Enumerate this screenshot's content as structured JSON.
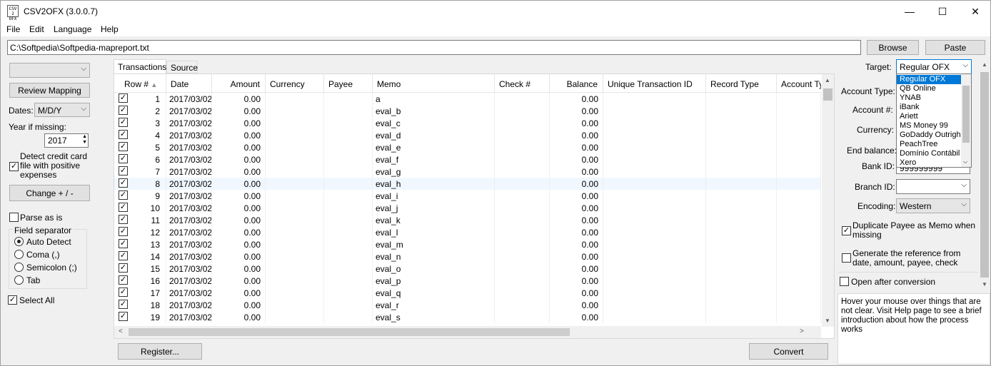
{
  "window": {
    "title": "CSV2OFX (3.0.0.7)",
    "icon_text": "CSV 2 OFX",
    "minimize": "—",
    "maximize": "☐",
    "close": "✕"
  },
  "menu": [
    "File",
    "Edit",
    "Language",
    "Help"
  ],
  "path": {
    "value": "C:\\Softpedia\\Softpedia-mapreport.txt"
  },
  "buttons": {
    "browse": "Browse",
    "paste": "Paste",
    "review_mapping": "Review Mapping",
    "change_sign": "Change + / -",
    "register": "Register...",
    "convert": "Convert"
  },
  "left": {
    "profile_value": "",
    "dates_label": "Dates:",
    "dates_value": "M/D/Y",
    "year_label": "Year if missing:",
    "year_value": "2017",
    "detect_credit": "Detect credit card file with positive expenses",
    "detect_credit_lines": [
      "Detect credit card",
      "file with positive",
      "expenses"
    ],
    "parse_as_is": "Parse as is",
    "field_sep_label": "Field separator",
    "separators": [
      "Auto Detect",
      "Coma (,)",
      "Semicolon (;)",
      "Tab"
    ],
    "selected_separator": "Auto Detect",
    "select_all": "Select All"
  },
  "tabs": [
    "Transactions",
    "Source"
  ],
  "grid": {
    "columns": [
      "Row #",
      "Date",
      "Amount",
      "Currency",
      "Payee",
      "Memo",
      "Check #",
      "Balance",
      "Unique Transaction ID",
      "Record Type",
      "Account Ty"
    ],
    "rows": [
      {
        "n": "1",
        "date": "2017/03/02",
        "amount": "0.00",
        "memo": "a",
        "balance": "0.00"
      },
      {
        "n": "2",
        "date": "2017/03/02",
        "amount": "0.00",
        "memo": "eval_b",
        "balance": "0.00"
      },
      {
        "n": "3",
        "date": "2017/03/02",
        "amount": "0.00",
        "memo": "eval_c",
        "balance": "0.00"
      },
      {
        "n": "4",
        "date": "2017/03/02",
        "amount": "0.00",
        "memo": "eval_d",
        "balance": "0.00"
      },
      {
        "n": "5",
        "date": "2017/03/02",
        "amount": "0.00",
        "memo": "eval_e",
        "balance": "0.00"
      },
      {
        "n": "6",
        "date": "2017/03/02",
        "amount": "0.00",
        "memo": "eval_f",
        "balance": "0.00"
      },
      {
        "n": "7",
        "date": "2017/03/02",
        "amount": "0.00",
        "memo": "eval_g",
        "balance": "0.00"
      },
      {
        "n": "8",
        "date": "2017/03/02",
        "amount": "0.00",
        "memo": "eval_h",
        "balance": "0.00"
      },
      {
        "n": "9",
        "date": "2017/03/02",
        "amount": "0.00",
        "memo": "eval_i",
        "balance": "0.00"
      },
      {
        "n": "10",
        "date": "2017/03/02",
        "amount": "0.00",
        "memo": "eval_j",
        "balance": "0.00"
      },
      {
        "n": "11",
        "date": "2017/03/02",
        "amount": "0.00",
        "memo": "eval_k",
        "balance": "0.00"
      },
      {
        "n": "12",
        "date": "2017/03/02",
        "amount": "0.00",
        "memo": "eval_l",
        "balance": "0.00"
      },
      {
        "n": "13",
        "date": "2017/03/02",
        "amount": "0.00",
        "memo": "eval_m",
        "balance": "0.00"
      },
      {
        "n": "14",
        "date": "2017/03/02",
        "amount": "0.00",
        "memo": "eval_n",
        "balance": "0.00"
      },
      {
        "n": "15",
        "date": "2017/03/02",
        "amount": "0.00",
        "memo": "eval_o",
        "balance": "0.00"
      },
      {
        "n": "16",
        "date": "2017/03/02",
        "amount": "0.00",
        "memo": "eval_p",
        "balance": "0.00"
      },
      {
        "n": "17",
        "date": "2017/03/02",
        "amount": "0.00",
        "memo": "eval_q",
        "balance": "0.00"
      },
      {
        "n": "18",
        "date": "2017/03/02",
        "amount": "0.00",
        "memo": "eval_r",
        "balance": "0.00"
      },
      {
        "n": "19",
        "date": "2017/03/02",
        "amount": "0.00",
        "memo": "eval_s",
        "balance": "0.00"
      }
    ]
  },
  "right": {
    "target_label": "Target:",
    "target_value": "Regular OFX",
    "target_options": [
      "Regular OFX",
      "QB Online",
      "YNAB",
      "iBank",
      "Ariett",
      "MS Money 99",
      "GoDaddy Outrigh",
      "PeachTree",
      "Domínio Contábil",
      "Xero"
    ],
    "account_type_label": "Account Type:",
    "account_num_label": "Account #:",
    "currency_label": "Currency:",
    "end_balance_label": "End balance:",
    "bank_id_label": "Bank ID:",
    "bank_id_value": "999999999",
    "branch_id_label": "Branch ID:",
    "encoding_label": "Encoding:",
    "encoding_value": "Western",
    "dup_payee": "Duplicate Payee as Memo when missing",
    "dup_payee_lines": [
      "Duplicate Payee as Memo when",
      "missing"
    ],
    "gen_ref": "Generate the reference from date, amount, payee, check",
    "gen_ref_lines": [
      "Generate the reference from",
      "date, amount, payee, check"
    ],
    "open_after": "Open after conversion"
  },
  "help_text": "Hover your mouse over things that are not clear. Visit Help page to see a brief introduction about how the process works"
}
